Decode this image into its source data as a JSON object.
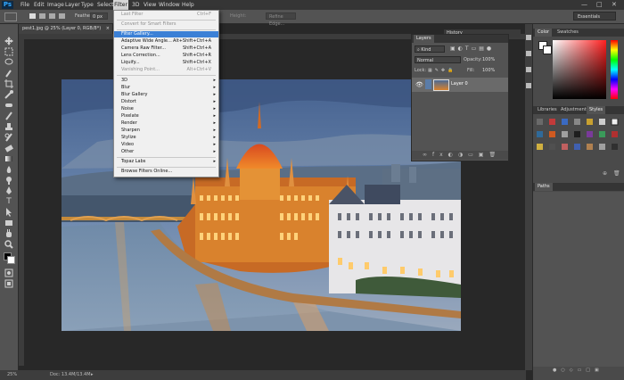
{
  "menubar": {
    "logo": "Ps",
    "items": [
      "File",
      "Edit",
      "Image",
      "Layer",
      "Type",
      "Select",
      "Filter",
      "3D",
      "View",
      "Window",
      "Help"
    ],
    "active": "Filter",
    "window_controls": [
      "—",
      "□",
      "✕"
    ]
  },
  "options_bar": {
    "feather_label": "Feather:",
    "feather_value": "0 px",
    "height_label": "Height:",
    "refine_edge_label": "Refine Edge...",
    "workspace": "Essentials"
  },
  "document": {
    "tab_title": "pest1.jpg @ 25% (Layer 0, RGB/8*)",
    "close": "×"
  },
  "status_bar": {
    "zoom": "25%",
    "doc_info": "Doc: 13.4M/13.4M"
  },
  "filter_menu": {
    "items": [
      {
        "label": "Last Filter",
        "shortcut": "Ctrl+F",
        "state": "disabled"
      },
      {
        "sep": true
      },
      {
        "label": "Convert for Smart Filters",
        "state": "disabled"
      },
      {
        "sep": true
      },
      {
        "label": "Filter Gallery...",
        "state": "highlighted"
      },
      {
        "label": "Adaptive Wide Angle...",
        "shortcut": "Alt+Shift+Ctrl+A"
      },
      {
        "label": "Camera Raw Filter...",
        "shortcut": "Shift+Ctrl+A"
      },
      {
        "label": "Lens Correction...",
        "shortcut": "Shift+Ctrl+R"
      },
      {
        "label": "Liquify...",
        "shortcut": "Shift+Ctrl+X"
      },
      {
        "label": "Vanishing Point...",
        "shortcut": "Alt+Ctrl+V",
        "state": "disabled"
      },
      {
        "sep": true
      },
      {
        "label": "3D",
        "submenu": true
      },
      {
        "label": "Blur",
        "submenu": true
      },
      {
        "label": "Blur Gallery",
        "submenu": true
      },
      {
        "label": "Distort",
        "submenu": true
      },
      {
        "label": "Noise",
        "submenu": true
      },
      {
        "label": "Pixelate",
        "submenu": true
      },
      {
        "label": "Render",
        "submenu": true
      },
      {
        "label": "Sharpen",
        "submenu": true
      },
      {
        "label": "Stylize",
        "submenu": true
      },
      {
        "label": "Video",
        "submenu": true
      },
      {
        "label": "Other",
        "submenu": true
      },
      {
        "sep": true
      },
      {
        "label": "Topaz Labs",
        "submenu": true
      },
      {
        "sep": true
      },
      {
        "label": "Browse Filters Online..."
      }
    ]
  },
  "layers_panel": {
    "tab": "Layers",
    "history_tab": "History",
    "kind_label": "Kind",
    "blend_mode": "Normal",
    "opacity_label": "Opacity:",
    "opacity_value": "100%",
    "lock_label": "Lock:",
    "fill_label": "Fill:",
    "fill_value": "100%",
    "layer_name": "Layer 0"
  },
  "right_panels": {
    "color_tabs": [
      "Color",
      "Swatches"
    ],
    "lib_tabs": [
      "Libraries",
      "Adjustments",
      "Styles"
    ],
    "paths_tab": "Paths",
    "foreground_color": "#ffffff",
    "picker_hue": "#ff2020"
  }
}
